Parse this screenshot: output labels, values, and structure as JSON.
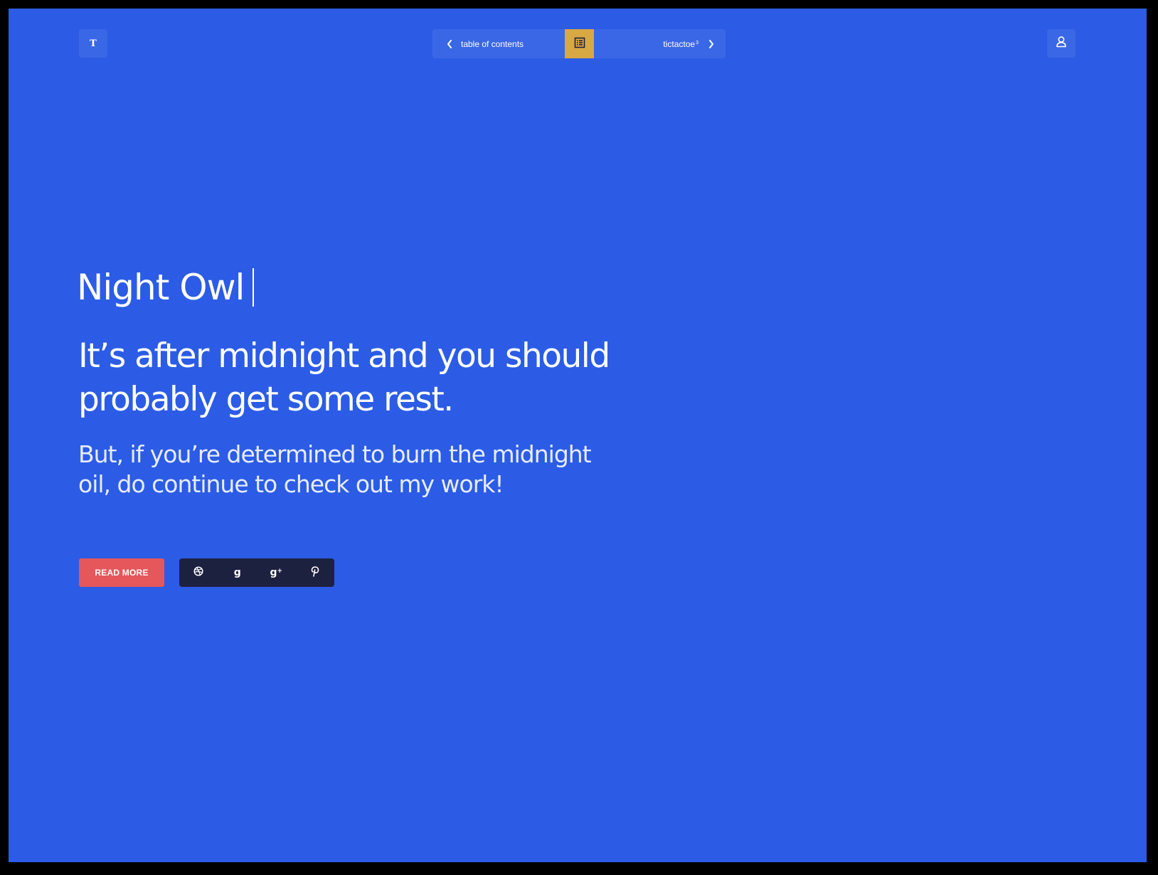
{
  "header": {
    "logo_letter": "T",
    "nav": {
      "prev_label": "table of contents",
      "next_label": "tictactoe",
      "next_superscript": "3"
    }
  },
  "hero": {
    "title": "Night Owl",
    "headline": "It’s after midnight and you should probably get some rest.",
    "subtext": "But, if you’re determined to burn the midnight oil, do continue to check out my work!"
  },
  "actions": {
    "read_more_label": "READ MORE",
    "social": [
      {
        "name": "dribbble-icon"
      },
      {
        "name": "gowalla-icon",
        "glyph": "g"
      },
      {
        "name": "google-plus-icon",
        "glyph": "g",
        "sup": "+"
      },
      {
        "name": "pinterest-icon"
      }
    ]
  },
  "colors": {
    "background": "#2c5ce5",
    "outer_frame": "#000000",
    "nav_center_accent": "#d7a844",
    "read_more": "#e5575a",
    "social_bar": "#1d2140",
    "text": "#ffffff"
  }
}
